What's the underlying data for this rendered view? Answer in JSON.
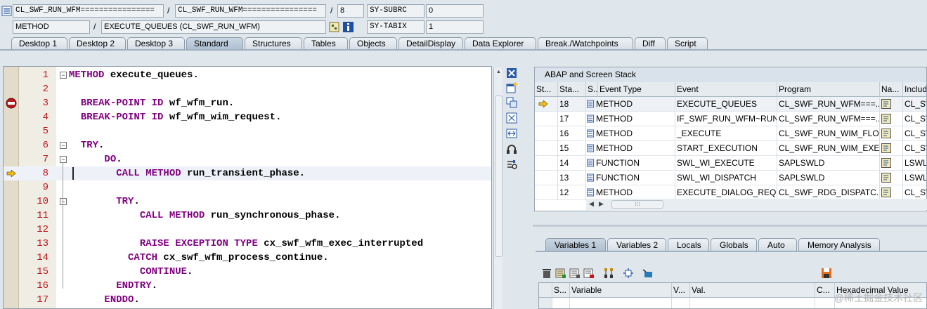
{
  "header": {
    "row1": {
      "program": "CL_SWF_RUN_WFM================",
      "include": "CL_SWF_RUN_WFM================",
      "line": "8",
      "sysvar_name": "SY-SUBRC",
      "sysvar_value": "0"
    },
    "row2": {
      "event_type": "METHOD",
      "event": "EXECUTE_QUEUES (CL_SWF_RUN_WFM)",
      "sysvar_name": "SY-TABIX",
      "sysvar_value": "1"
    },
    "separator": "/"
  },
  "tabs": [
    "Desktop 1",
    "Desktop 2",
    "Desktop 3",
    "Standard",
    "Structures",
    "Tables",
    "Objects",
    "DetailDisplay",
    "Data Explorer",
    "Break./Watchpoints",
    "Diff",
    "Script"
  ],
  "active_tab": "Standard",
  "editor": {
    "lines": [
      {
        "num": "1",
        "code": "<span class='kw'>METHOD</span> execute_queues."
      },
      {
        "num": "2",
        "code": ""
      },
      {
        "num": "3",
        "code": "  <span class='kw'>BREAK-POINT ID</span> wf_wfm_run."
      },
      {
        "num": "4",
        "code": "  <span class='kw'>BREAK-POINT ID</span> wf_wfm_wim_request."
      },
      {
        "num": "5",
        "code": ""
      },
      {
        "num": "6",
        "code": "  <span class='kw'>TRY</span>."
      },
      {
        "num": "7",
        "code": "      <span class='kw'>DO</span>."
      },
      {
        "num": "8",
        "code": "        <span class='kw'>CALL METHOD</span> run_transient_phase."
      },
      {
        "num": "9",
        "code": ""
      },
      {
        "num": "10",
        "code": "        <span class='kw'>TRY</span>."
      },
      {
        "num": "11",
        "code": "            <span class='kw'>CALL METHOD</span> run_synchronous_phase."
      },
      {
        "num": "12",
        "code": ""
      },
      {
        "num": "13",
        "code": "            <span class='kw'>RAISE EXCEPTION TYPE</span> cx_swf_wfm_exec_interrupted"
      },
      {
        "num": "14",
        "code": "          <span class='kw'>CATCH</span> cx_swf_wfm_process_continue."
      },
      {
        "num": "15",
        "code": "            <span class='kw'>CONTINUE</span>."
      },
      {
        "num": "16",
        "code": "        <span class='kw'>ENDTRY</span>."
      },
      {
        "num": "17",
        "code": "      <span class='kw'>ENDDO</span>."
      }
    ],
    "current_line": "8",
    "breakpoint_line": "3"
  },
  "stack": {
    "title": "ABAP and Screen Stack",
    "columns": [
      "St...",
      "Sta...",
      "S...",
      "Event Type",
      "Event",
      "Program",
      "Na...",
      "Include"
    ],
    "rows": [
      {
        "stack": "18",
        "event_type": "METHOD",
        "event": "EXECUTE_QUEUES",
        "program": "CL_SWF_RUN_WFM===...",
        "include": "CL_SW"
      },
      {
        "stack": "17",
        "event_type": "METHOD",
        "event": "IF_SWF_RUN_WFM~RUN",
        "program": "CL_SWF_RUN_WFM===...",
        "include": "CL_SW"
      },
      {
        "stack": "16",
        "event_type": "METHOD",
        "event": "_EXECUTE",
        "program": "CL_SWF_RUN_WIM_FLO...",
        "include": "CL_SW"
      },
      {
        "stack": "15",
        "event_type": "METHOD",
        "event": "START_EXECUTION",
        "program": "CL_SWF_RUN_WIM_EXE...",
        "include": "CL_SW"
      },
      {
        "stack": "14",
        "event_type": "FUNCTION",
        "event": "SWL_WI_EXECUTE",
        "program": "SAPLSWLD",
        "include": "LSWLD"
      },
      {
        "stack": "13",
        "event_type": "FUNCTION",
        "event": "SWL_WI_DISPATCH",
        "program": "SAPLSWLD",
        "include": "LSWLD"
      },
      {
        "stack": "12",
        "event_type": "METHOD",
        "event": "EXECUTE_DIALOG_REQ...",
        "program": "CL_SWF_RDG_DISPATC...",
        "include": "CL_SW"
      }
    ]
  },
  "var_tabs": [
    "Variables 1",
    "Variables 2",
    "Locals",
    "Globals",
    "Auto",
    "Memory Analysis"
  ],
  "active_var_tab": "Variables 1",
  "vars": {
    "columns": [
      "S...",
      "Variable",
      "V...",
      "Val.",
      "C...",
      "Hexadecimal Value"
    ]
  },
  "watermark": "@稀土掘金技术社区",
  "colors": {
    "keyword": "#7f007f",
    "line_number": "#c0141c",
    "background": "#dfe6ec"
  }
}
